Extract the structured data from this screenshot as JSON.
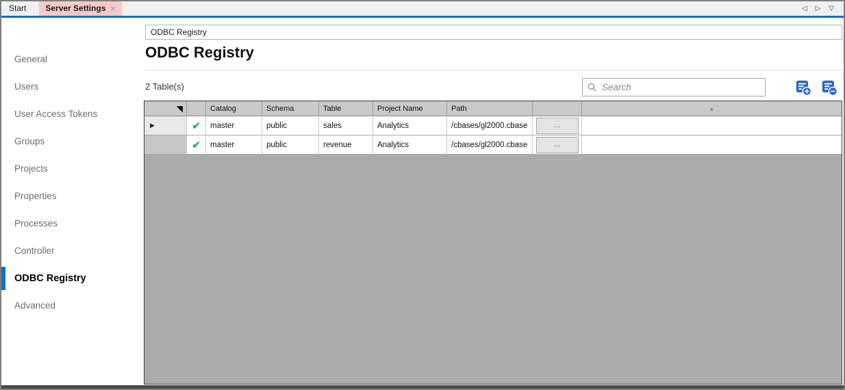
{
  "tab_bar": {
    "tabs": [
      {
        "label": "Start",
        "active": false
      },
      {
        "label": "Server Settings",
        "active": true
      }
    ]
  },
  "icons": {
    "close": "×",
    "nav_left": "◁",
    "nav_right": "▷",
    "nav_down": "▽",
    "select_all": "◥",
    "sort_asc": "▲",
    "current_row": "▶",
    "check": "✔"
  },
  "sidebar": {
    "items": [
      {
        "label": "General",
        "active": false
      },
      {
        "label": "Users",
        "active": false
      },
      {
        "label": "User Access Tokens",
        "active": false
      },
      {
        "label": "Groups",
        "active": false
      },
      {
        "label": "Projects",
        "active": false
      },
      {
        "label": "Properties",
        "active": false
      },
      {
        "label": "Processes",
        "active": false
      },
      {
        "label": "Controller",
        "active": false
      },
      {
        "label": "ODBC Registry",
        "active": true
      },
      {
        "label": "Advanced",
        "active": false
      }
    ]
  },
  "main": {
    "breadcrumb_value": "ODBC Registry",
    "title": "ODBC Registry",
    "count_label": "2 Table(s)",
    "search": {
      "placeholder": "Search"
    },
    "table": {
      "columns": [
        "Catalog",
        "Schema",
        "Table",
        "Project Name",
        "Path"
      ],
      "browse_label": "...",
      "rows": [
        {
          "catalog": "master",
          "schema": "public",
          "table": "sales",
          "project": "Analytics",
          "path": "/cbases/gl2000.cbase"
        },
        {
          "catalog": "master",
          "schema": "public",
          "table": "revenue",
          "project": "Analytics",
          "path": "/cbases/gl2000.cbase"
        }
      ]
    }
  },
  "colors": {
    "accent_blue": "#0e6fc4",
    "active_tab_pink": "#f5caca",
    "check_green": "#2db34a",
    "icon_blue": "#2e66c8",
    "grid_gray": "#ababab"
  }
}
